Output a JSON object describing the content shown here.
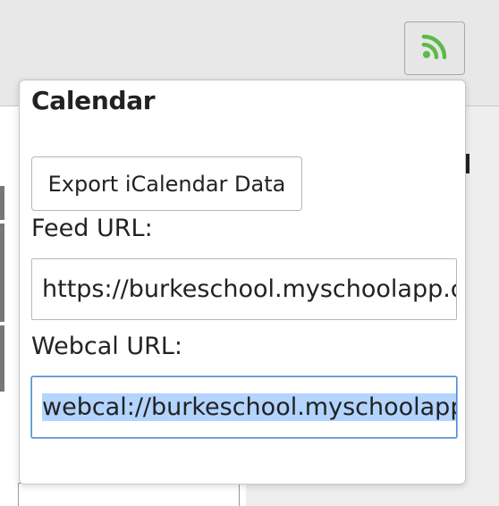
{
  "rss_button": {
    "icon": "rss-icon",
    "icon_color": "#5db94a"
  },
  "popover": {
    "title": "Calendar",
    "export_button_label": "Export iCalendar Data",
    "feed_url_label": "Feed URL:",
    "feed_url_value": "https://burkeschool.myschoolapp.com",
    "webcal_url_label": "Webcal URL:",
    "webcal_url_value": "webcal://burkeschool.myschoolapp.com"
  },
  "colors": {
    "focus_border": "#4c8fd6",
    "selection": "#b3d4fd"
  }
}
